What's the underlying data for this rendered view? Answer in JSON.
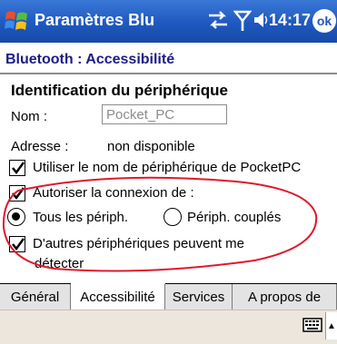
{
  "titlebar": {
    "app_title": "Paramètres Blu",
    "time": "14:17",
    "ok_label": "ok"
  },
  "header": {
    "page_title": "Bluetooth : Accessibilité"
  },
  "identification": {
    "section_title": "Identification du périphérique",
    "name_label": "Nom :",
    "name_value": "Pocket_PC",
    "address_label": "Adresse :",
    "address_value": "non disponible"
  },
  "options": {
    "use_device_name": {
      "label": "Utiliser le nom de périphérique de PocketPC",
      "checked": true
    },
    "allow_connection": {
      "label": "Autoriser la connexion de :",
      "checked": true
    },
    "radio_all": {
      "label": "Tous les périph.",
      "selected": true
    },
    "radio_paired": {
      "label": "Périph. couplés",
      "selected": false
    },
    "discoverable": {
      "line1": "D'autres périphériques peuvent me",
      "line2": "détecter",
      "checked": true
    }
  },
  "tabs": [
    {
      "label": "Général",
      "active": false
    },
    {
      "label": "Accessibilité",
      "active": true
    },
    {
      "label": "Services",
      "active": false
    },
    {
      "label": "A propos de",
      "active": false
    }
  ],
  "colors": {
    "titlebar": "#1f58c0",
    "page_title": "#1c1c8a",
    "annotation": "#e0182c",
    "menubar": "#ece6dc"
  },
  "icons": {
    "start": "windows-flag-icon",
    "connectivity": "connectivity-arrows-icon",
    "signal": "signal-antenna-icon",
    "volume": "speaker-icon",
    "keyboard": "keyboard-icon",
    "sip": "up-arrow-icon"
  }
}
